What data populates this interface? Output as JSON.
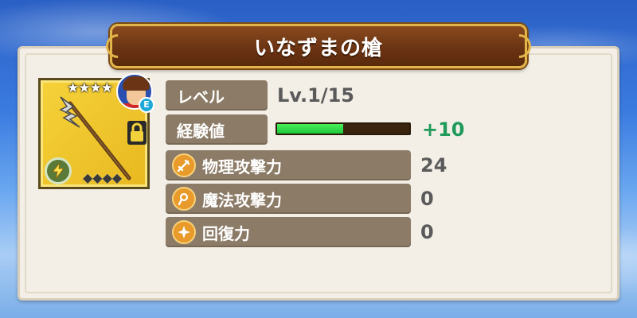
{
  "title": "いなずまの槍",
  "item": {
    "stars": "★★★★",
    "rank_badge": "E",
    "gems": "◆◆◆◆",
    "element_icon": "lightning-icon",
    "lock_icon": "lock-icon"
  },
  "level": {
    "label": "レベル",
    "value": "Lv.1/15"
  },
  "experience": {
    "label": "経験値",
    "gain": "+10",
    "progress": 0.5
  },
  "stats": [
    {
      "label": "物理攻撃力",
      "value": "24",
      "icon": "sword-icon"
    },
    {
      "label": "魔法攻撃力",
      "value": "0",
      "icon": "magic-icon"
    },
    {
      "label": "回復力",
      "value": "0",
      "icon": "sparkle-icon"
    }
  ],
  "colors": {
    "banner": "#6b3413",
    "card": "#f6d23a",
    "exp_fill": "#1cc83a",
    "gain_text": "#1f9a5a"
  }
}
